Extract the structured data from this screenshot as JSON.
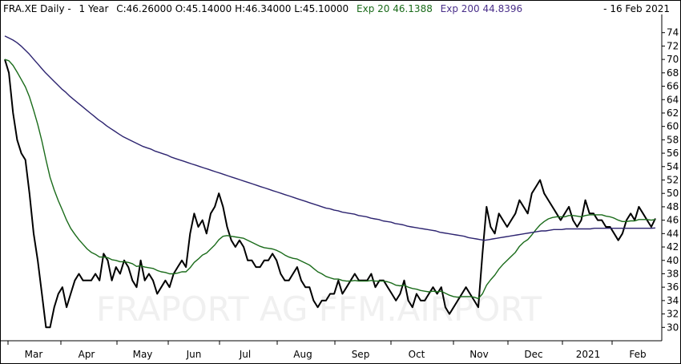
{
  "header": {
    "symbol": "FRA.XE Daily -",
    "period": "1 Year",
    "ohlc": "C:46.26000 O:45.14000 H:46.34000 L:45.10000",
    "ema20_label": "Exp 20 46.1388",
    "ema200_label": "Exp 200 44.8396",
    "date_label": "- 16 Feb 2021"
  },
  "watermark": "FRAPORT AG FFM.AIRPORT",
  "colors": {
    "price": "#000000",
    "ema20": "#1a6b1a",
    "ema200": "#2d2470",
    "text_green": "#1a6b1a",
    "text_purple": "#4a2f8a"
  },
  "chart_data": {
    "type": "line",
    "title": "FRA.XE Daily - 1 Year",
    "xlabel": "",
    "ylabel": "",
    "ylim": [
      28,
      76
    ],
    "y_ticks": [
      30,
      32,
      34,
      36,
      38,
      40,
      42,
      44,
      46,
      48,
      50,
      52,
      54,
      56,
      58,
      60,
      62,
      64,
      66,
      68,
      70,
      72,
      74
    ],
    "x_months": [
      "Mar",
      "Apr",
      "May",
      "Jun",
      "Jul",
      "Aug",
      "Sep",
      "Oct",
      "Nov",
      "Dec",
      "2021",
      "Feb"
    ],
    "series": [
      {
        "name": "FRA.XE",
        "values": [
          70,
          68,
          62,
          58,
          56,
          55,
          50,
          44,
          40,
          35,
          30,
          30,
          33,
          35,
          36,
          33,
          35,
          37,
          38,
          37,
          37,
          37,
          38,
          37,
          41,
          40,
          37,
          39,
          38,
          40,
          39,
          37,
          36,
          40,
          37,
          38,
          37,
          35,
          36,
          37,
          36,
          38,
          39,
          40,
          39,
          44,
          47,
          45,
          46,
          44,
          47,
          48,
          50,
          48,
          45,
          43,
          42,
          43,
          42,
          40,
          40,
          39,
          39,
          40,
          40,
          41,
          40,
          38,
          37,
          37,
          38,
          39,
          37,
          36,
          36,
          34,
          33,
          34,
          34,
          35,
          35,
          37,
          35,
          36,
          37,
          38,
          37,
          37,
          37,
          38,
          36,
          37,
          37,
          36,
          35,
          34,
          35,
          37,
          34,
          33,
          35,
          34,
          34,
          35,
          36,
          35,
          36,
          33,
          32,
          33,
          34,
          35,
          36,
          35,
          34,
          33,
          41,
          48,
          45,
          44,
          47,
          46,
          45,
          46,
          47,
          49,
          48,
          47,
          50,
          51,
          52,
          50,
          49,
          48,
          47,
          46,
          47,
          48,
          46,
          45,
          46,
          49,
          47,
          47,
          46,
          46,
          45,
          45,
          44,
          43,
          44,
          46,
          47,
          46,
          48,
          47,
          46,
          45,
          46.26
        ]
      },
      {
        "name": "Exp 20",
        "values": [
          70,
          69.8,
          69.1,
          68.1,
          67,
          65.9,
          64.4,
          62.4,
          60.3,
          57.8,
          55,
          52.4,
          50.5,
          48.9,
          47.5,
          46,
          44.8,
          43.9,
          43.1,
          42.4,
          41.7,
          41.2,
          40.9,
          40.5,
          40.5,
          40.4,
          40.1,
          40,
          39.8,
          39.8,
          39.7,
          39.5,
          39.1,
          39.2,
          39,
          38.9,
          38.8,
          38.5,
          38.3,
          38.2,
          38,
          38,
          38.1,
          38.3,
          38.3,
          38.9,
          39.7,
          40.2,
          40.8,
          41.1,
          41.7,
          42.3,
          43.1,
          43.6,
          43.7,
          43.6,
          43.5,
          43.4,
          43.3,
          43,
          42.7,
          42.4,
          42.1,
          41.9,
          41.8,
          41.7,
          41.5,
          41.2,
          40.8,
          40.5,
          40.3,
          40.2,
          39.9,
          39.6,
          39.3,
          38.8,
          38.3,
          38,
          37.6,
          37.4,
          37.2,
          37.2,
          37,
          36.9,
          36.9,
          37,
          36.9,
          36.9,
          36.9,
          37,
          36.9,
          36.9,
          36.9,
          36.8,
          36.6,
          36.3,
          36.2,
          36.3,
          36,
          35.8,
          35.7,
          35.5,
          35.4,
          35.3,
          35.4,
          35.3,
          35.4,
          35.1,
          34.8,
          34.6,
          34.5,
          34.6,
          34.6,
          34.6,
          34.5,
          34.3,
          35,
          36.3,
          37.1,
          37.8,
          38.7,
          39.4,
          40,
          40.6,
          41.2,
          42.1,
          42.7,
          43.1,
          43.8,
          44.6,
          45.3,
          45.8,
          46.2,
          46.4,
          46.5,
          46.5,
          46.5,
          46.7,
          46.7,
          46.6,
          46.5,
          46.7,
          46.8,
          46.8,
          46.8,
          46.8,
          46.6,
          46.5,
          46.3,
          46,
          45.8,
          45.8,
          45.9,
          45.9,
          46.1,
          46.1,
          46.1,
          46,
          46.1
        ]
      },
      {
        "name": "Exp 200",
        "values": [
          73.5,
          73.2,
          72.9,
          72.5,
          72,
          71.4,
          70.8,
          70.1,
          69.4,
          68.7,
          68,
          67.4,
          66.8,
          66.2,
          65.6,
          65.1,
          64.5,
          64,
          63.5,
          63,
          62.5,
          62,
          61.5,
          61,
          60.6,
          60.1,
          59.7,
          59.3,
          58.9,
          58.5,
          58.2,
          57.9,
          57.6,
          57.3,
          57,
          56.8,
          56.6,
          56.3,
          56.1,
          55.9,
          55.7,
          55.4,
          55.2,
          55,
          54.8,
          54.6,
          54.4,
          54.2,
          54,
          53.8,
          53.6,
          53.4,
          53.2,
          53,
          52.8,
          52.6,
          52.4,
          52.2,
          52,
          51.8,
          51.6,
          51.4,
          51.2,
          51,
          50.8,
          50.6,
          50.4,
          50.2,
          50,
          49.8,
          49.6,
          49.4,
          49.2,
          49,
          48.8,
          48.6,
          48.4,
          48.2,
          48,
          47.8,
          47.7,
          47.5,
          47.4,
          47.2,
          47.1,
          47,
          46.9,
          46.7,
          46.6,
          46.5,
          46.3,
          46.2,
          46.1,
          45.9,
          45.8,
          45.7,
          45.5,
          45.4,
          45.3,
          45.1,
          45,
          44.9,
          44.8,
          44.7,
          44.6,
          44.5,
          44.4,
          44.2,
          44.1,
          44,
          43.9,
          43.8,
          43.7,
          43.6,
          43.4,
          43.3,
          43.2,
          43.1,
          43,
          43.1,
          43.2,
          43.3,
          43.4,
          43.5,
          43.6,
          43.7,
          43.8,
          43.9,
          44,
          44.1,
          44.2,
          44.3,
          44.4,
          44.4,
          44.5,
          44.6,
          44.6,
          44.6,
          44.7,
          44.7,
          44.7,
          44.7,
          44.7,
          44.7,
          44.7,
          44.8,
          44.8,
          44.8,
          44.8,
          44.8,
          44.8,
          44.8,
          44.8,
          44.8,
          44.8,
          44.8,
          44.8,
          44.8,
          44.8,
          44.8,
          44.84
        ]
      }
    ],
    "grid": false,
    "legend": "top"
  }
}
